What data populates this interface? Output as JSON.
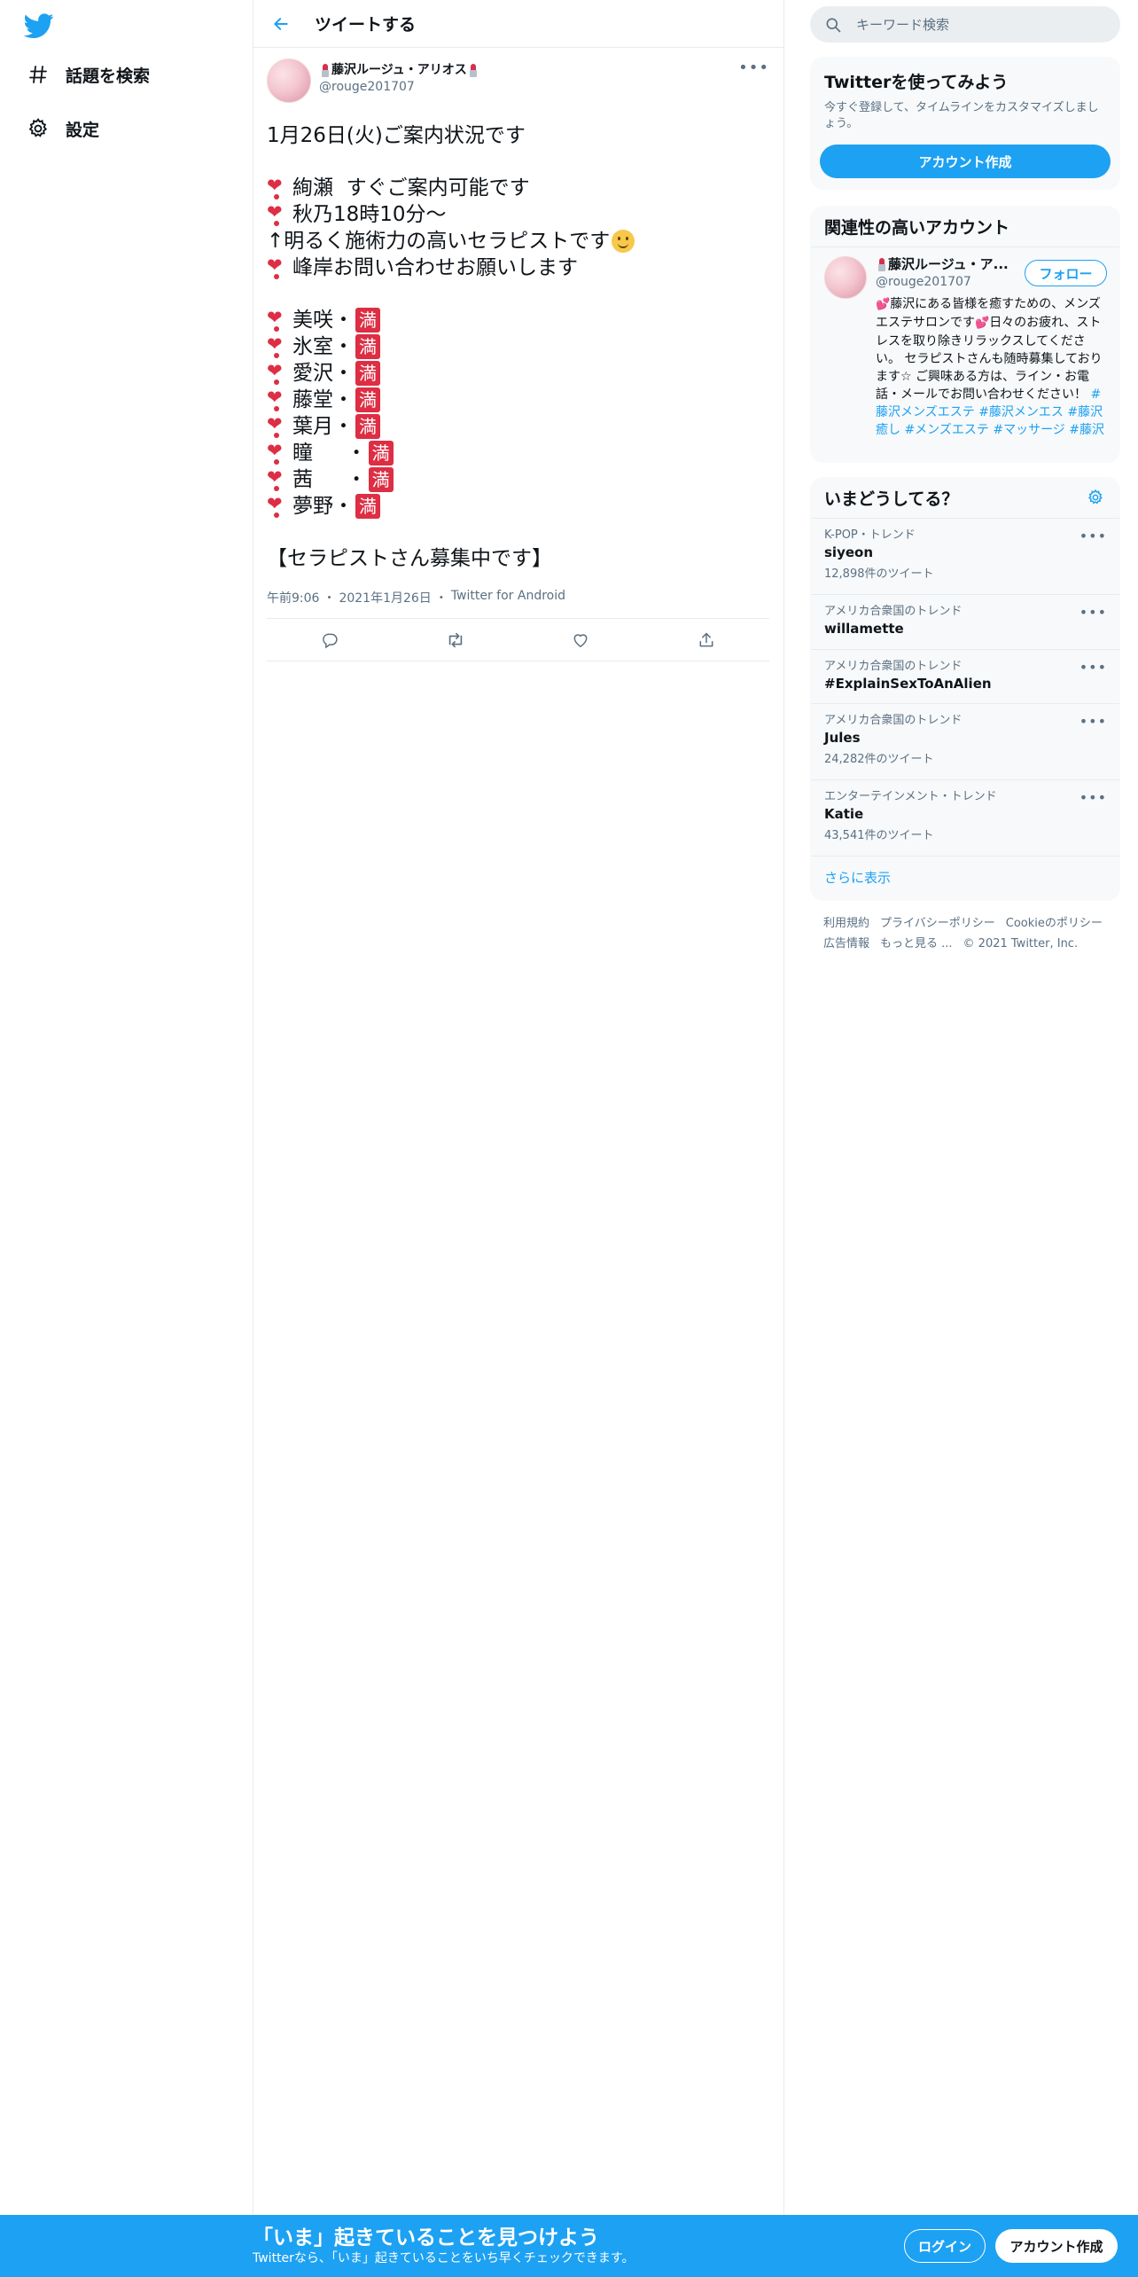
{
  "colors": {
    "brand": "#1da1f2",
    "text": "#0f1419",
    "muted": "#5b7083",
    "heart": "#dd2e44",
    "border": "#e6ecf0"
  },
  "nav": {
    "logo_icon": "twitter-bird-icon",
    "items": [
      {
        "label": "話題を検索",
        "icon": "hash-icon"
      },
      {
        "label": "設定",
        "icon": "gear-icon"
      }
    ]
  },
  "header": {
    "title": "ツイートする",
    "back_icon": "arrow-left-icon"
  },
  "tweet": {
    "author_name": "藤沢ルージュ・アリオス",
    "author_handle": "@rouge201707",
    "more_icon": "more-horizontal-icon",
    "lines": {
      "l1": "1月26日(火)ご案内状況です",
      "l2": "絢瀬  すぐご案内可能です",
      "l3": "秋乃18時10分～",
      "l4": "↑明るく施術力の高いセラピストです",
      "l5": "峰岸お問い合わせお願いします",
      "l6": "美咲・",
      "l7": "氷室・",
      "l8": "愛沢・",
      "l9": "藤堂・",
      "l10": "葉月・",
      "l11": "瞳　  ・",
      "l12": "茜　  ・",
      "l13": "夢野・",
      "l14": "【セラピストさん募集中です】"
    },
    "full_badge": "満",
    "meta": {
      "time": "午前9:06",
      "sep": "・",
      "date": "2021年1月26日",
      "source": "Twitter for Android"
    },
    "actions": [
      "reply-icon",
      "retweet-icon",
      "like-icon",
      "share-icon"
    ]
  },
  "search": {
    "placeholder": "キーワード検索"
  },
  "signup_card": {
    "title": "Twitterを使ってみよう",
    "description": "今すぐ登録して、タイムラインをカスタマイズしましょう。",
    "button": "アカウント作成"
  },
  "relevant": {
    "title": "関連性の高いアカウント",
    "name": "藤沢ルージュ・ア...",
    "handle": "@rouge201707",
    "follow": "フォロー",
    "bio_text": "藤沢にある皆様を癒すための、メンズエステサロンです日々のお疲れ、ストレスを取り除きリラックスしてください。 セラピストさんも随時募集しております☆ ご興味ある方は、ライン・お電話・メールでお問い合わせください！",
    "bio_part1": "藤沢にある皆様を癒すための、メンズエステサロンです",
    "bio_part2": "日々のお疲れ、ストレスを取り除きリラックスしてください。 セラピストさんも随時募集しております☆ ご興味ある方は、ライン・お電話・メールでお問い合わせください！ ",
    "tags": [
      "#藤沢メンズエステ",
      "#藤沢メンエス",
      "#藤沢癒し",
      "#メンズエステ",
      "#マッサージ",
      "#藤沢"
    ]
  },
  "trends": {
    "title": "いまどうしてる？",
    "items": [
      {
        "context": "K-POP・トレンド",
        "name": "siyeon",
        "count": "12,898件のツイート"
      },
      {
        "context": "アメリカ合衆国のトレンド",
        "name": "willamette",
        "count": ""
      },
      {
        "context": "アメリカ合衆国のトレンド",
        "name": "#ExplainSexToAnAlien",
        "count": ""
      },
      {
        "context": "アメリカ合衆国のトレンド",
        "name": "Jules",
        "count": "24,282件のツイート"
      },
      {
        "context": "エンターテインメント・トレンド",
        "name": "Katie",
        "count": "43,541件のツイート"
      }
    ],
    "show_more": "さらに表示"
  },
  "footer": {
    "terms": "利用規約",
    "privacy": "プライバシーポリシー",
    "cookie": "Cookieのポリシー",
    "ads": "広告情報",
    "more": "もっと見る ...",
    "copyright": "© 2021 Twitter, Inc."
  },
  "bottom_bar": {
    "headline": "「いま」起きていることを見つけよう",
    "subtext": "Twitterなら、「いま」起きていることをいち早くチェックできます。",
    "login": "ログイン",
    "signup": "アカウント作成"
  }
}
